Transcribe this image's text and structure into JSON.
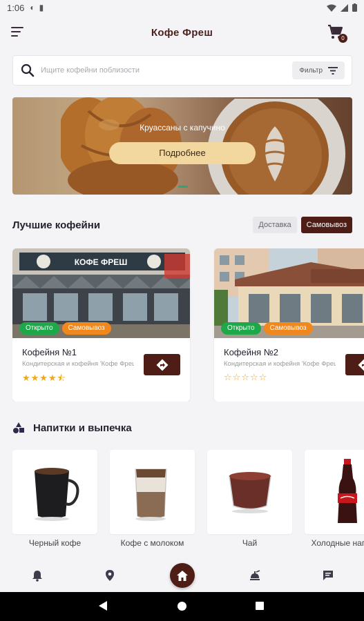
{
  "status_bar": {
    "time": "1:06",
    "icons": [
      "data-saver-icon",
      "sd-card-icon",
      "wifi-icon",
      "signal-icon",
      "battery-icon"
    ]
  },
  "app_bar": {
    "title": "Кофе Фреш",
    "menu_icon": "menu-icon",
    "cart_icon": "cart-icon",
    "cart_count": "0"
  },
  "search": {
    "placeholder": "Ищите кофейни поблизости",
    "filter_label": "Фильтр"
  },
  "banner": {
    "caption": "Круассаны с капучино",
    "button_label": "Подробнее"
  },
  "best_cafes": {
    "title": "Лучшие кофейни",
    "toggle_delivery": "Доставка",
    "toggle_pickup": "Самовывоз",
    "active_toggle": "Самовывоз",
    "items": [
      {
        "name": "Кофейня №1",
        "description": "Кондитерская и кофейня 'Кофе Фреш'",
        "status_tag": "Открыто",
        "mode_tag": "Самовывоз",
        "rating": 4.5,
        "stars": "★★★★⯪",
        "sign_text": "КОФЕ ФРЕШ"
      },
      {
        "name": "Кофейня №2",
        "description": "Кондитерская и кофейня 'Кофе Фреш'",
        "status_tag": "Открыто",
        "mode_tag": "Самовывоз",
        "rating": 0,
        "stars": "☆☆☆☆☆"
      }
    ]
  },
  "drinks_section": {
    "title": "Напитки и выпечка",
    "items": [
      {
        "label": "Черный кофе"
      },
      {
        "label": "Кофе с молоком"
      },
      {
        "label": "Чай"
      },
      {
        "label": "Холодные напитки"
      }
    ]
  },
  "bottom_nav": {
    "items": [
      "bell-icon",
      "location-pin-icon",
      "home-icon",
      "food-tray-icon",
      "chat-icon"
    ],
    "active": "home-icon"
  },
  "colors": {
    "brand": "#4e1e16",
    "accent_banner_button": "#f2d79e",
    "open_tag": "#1ea84a",
    "pickup_tag": "#f0881d",
    "star": "#f0a71a"
  }
}
